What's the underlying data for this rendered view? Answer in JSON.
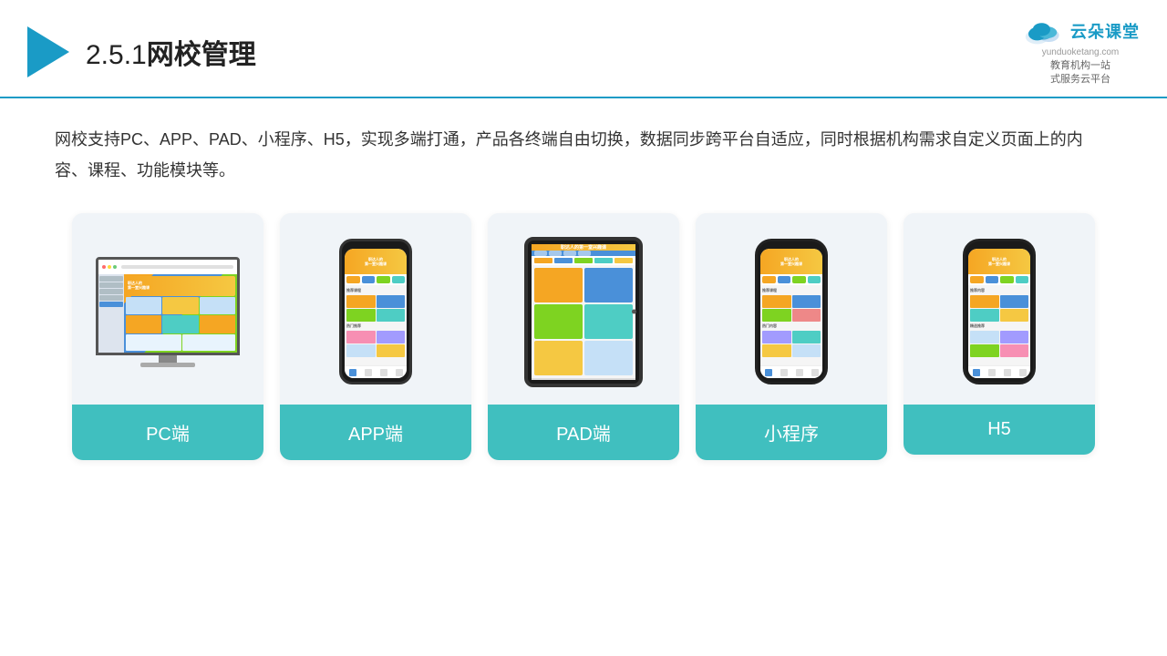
{
  "header": {
    "section_number": "2.5.1",
    "title": "网校管理",
    "brand_name": "云朵课堂",
    "brand_url": "yunduoketang.com",
    "brand_tagline": "教育机构一站\n式服务云平台"
  },
  "description": {
    "text": "网校支持PC、APP、PAD、小程序、H5，实现多端打通，产品各终端自由切换，数据同步跨平台自适应，同时根据机构需求自定义页面上的内容、课程、功能模块等。"
  },
  "cards": [
    {
      "id": "pc",
      "label": "PC端",
      "device": "pc"
    },
    {
      "id": "app",
      "label": "APP端",
      "device": "phone"
    },
    {
      "id": "pad",
      "label": "PAD端",
      "device": "pad"
    },
    {
      "id": "mini",
      "label": "小程序",
      "device": "phone"
    },
    {
      "id": "h5",
      "label": "H5",
      "device": "phone"
    }
  ],
  "colors": {
    "accent": "#1a9bc6",
    "card_label_bg": "#40bfbf",
    "card_bg": "#f0f4f8",
    "header_border": "#1a9bc6"
  }
}
